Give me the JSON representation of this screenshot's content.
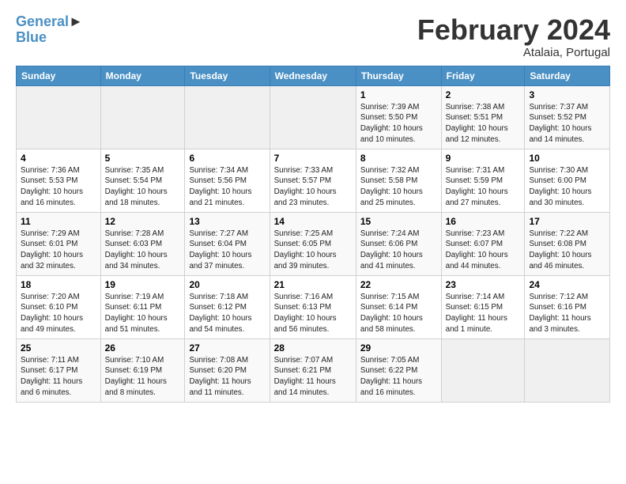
{
  "header": {
    "logo_line1": "General",
    "logo_line2": "Blue",
    "month": "February 2024",
    "location": "Atalaia, Portugal"
  },
  "days_of_week": [
    "Sunday",
    "Monday",
    "Tuesday",
    "Wednesday",
    "Thursday",
    "Friday",
    "Saturday"
  ],
  "weeks": [
    [
      {
        "day": "",
        "info": ""
      },
      {
        "day": "",
        "info": ""
      },
      {
        "day": "",
        "info": ""
      },
      {
        "day": "",
        "info": ""
      },
      {
        "day": "1",
        "info": "Sunrise: 7:39 AM\nSunset: 5:50 PM\nDaylight: 10 hours\nand 10 minutes."
      },
      {
        "day": "2",
        "info": "Sunrise: 7:38 AM\nSunset: 5:51 PM\nDaylight: 10 hours\nand 12 minutes."
      },
      {
        "day": "3",
        "info": "Sunrise: 7:37 AM\nSunset: 5:52 PM\nDaylight: 10 hours\nand 14 minutes."
      }
    ],
    [
      {
        "day": "4",
        "info": "Sunrise: 7:36 AM\nSunset: 5:53 PM\nDaylight: 10 hours\nand 16 minutes."
      },
      {
        "day": "5",
        "info": "Sunrise: 7:35 AM\nSunset: 5:54 PM\nDaylight: 10 hours\nand 18 minutes."
      },
      {
        "day": "6",
        "info": "Sunrise: 7:34 AM\nSunset: 5:56 PM\nDaylight: 10 hours\nand 21 minutes."
      },
      {
        "day": "7",
        "info": "Sunrise: 7:33 AM\nSunset: 5:57 PM\nDaylight: 10 hours\nand 23 minutes."
      },
      {
        "day": "8",
        "info": "Sunrise: 7:32 AM\nSunset: 5:58 PM\nDaylight: 10 hours\nand 25 minutes."
      },
      {
        "day": "9",
        "info": "Sunrise: 7:31 AM\nSunset: 5:59 PM\nDaylight: 10 hours\nand 27 minutes."
      },
      {
        "day": "10",
        "info": "Sunrise: 7:30 AM\nSunset: 6:00 PM\nDaylight: 10 hours\nand 30 minutes."
      }
    ],
    [
      {
        "day": "11",
        "info": "Sunrise: 7:29 AM\nSunset: 6:01 PM\nDaylight: 10 hours\nand 32 minutes."
      },
      {
        "day": "12",
        "info": "Sunrise: 7:28 AM\nSunset: 6:03 PM\nDaylight: 10 hours\nand 34 minutes."
      },
      {
        "day": "13",
        "info": "Sunrise: 7:27 AM\nSunset: 6:04 PM\nDaylight: 10 hours\nand 37 minutes."
      },
      {
        "day": "14",
        "info": "Sunrise: 7:25 AM\nSunset: 6:05 PM\nDaylight: 10 hours\nand 39 minutes."
      },
      {
        "day": "15",
        "info": "Sunrise: 7:24 AM\nSunset: 6:06 PM\nDaylight: 10 hours\nand 41 minutes."
      },
      {
        "day": "16",
        "info": "Sunrise: 7:23 AM\nSunset: 6:07 PM\nDaylight: 10 hours\nand 44 minutes."
      },
      {
        "day": "17",
        "info": "Sunrise: 7:22 AM\nSunset: 6:08 PM\nDaylight: 10 hours\nand 46 minutes."
      }
    ],
    [
      {
        "day": "18",
        "info": "Sunrise: 7:20 AM\nSunset: 6:10 PM\nDaylight: 10 hours\nand 49 minutes."
      },
      {
        "day": "19",
        "info": "Sunrise: 7:19 AM\nSunset: 6:11 PM\nDaylight: 10 hours\nand 51 minutes."
      },
      {
        "day": "20",
        "info": "Sunrise: 7:18 AM\nSunset: 6:12 PM\nDaylight: 10 hours\nand 54 minutes."
      },
      {
        "day": "21",
        "info": "Sunrise: 7:16 AM\nSunset: 6:13 PM\nDaylight: 10 hours\nand 56 minutes."
      },
      {
        "day": "22",
        "info": "Sunrise: 7:15 AM\nSunset: 6:14 PM\nDaylight: 10 hours\nand 58 minutes."
      },
      {
        "day": "23",
        "info": "Sunrise: 7:14 AM\nSunset: 6:15 PM\nDaylight: 11 hours\nand 1 minute."
      },
      {
        "day": "24",
        "info": "Sunrise: 7:12 AM\nSunset: 6:16 PM\nDaylight: 11 hours\nand 3 minutes."
      }
    ],
    [
      {
        "day": "25",
        "info": "Sunrise: 7:11 AM\nSunset: 6:17 PM\nDaylight: 11 hours\nand 6 minutes."
      },
      {
        "day": "26",
        "info": "Sunrise: 7:10 AM\nSunset: 6:19 PM\nDaylight: 11 hours\nand 8 minutes."
      },
      {
        "day": "27",
        "info": "Sunrise: 7:08 AM\nSunset: 6:20 PM\nDaylight: 11 hours\nand 11 minutes."
      },
      {
        "day": "28",
        "info": "Sunrise: 7:07 AM\nSunset: 6:21 PM\nDaylight: 11 hours\nand 14 minutes."
      },
      {
        "day": "29",
        "info": "Sunrise: 7:05 AM\nSunset: 6:22 PM\nDaylight: 11 hours\nand 16 minutes."
      },
      {
        "day": "",
        "info": ""
      },
      {
        "day": "",
        "info": ""
      }
    ]
  ]
}
